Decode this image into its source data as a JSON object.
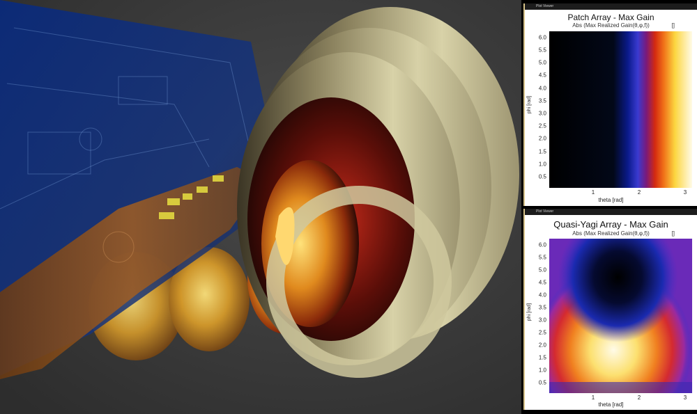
{
  "viewport": {
    "description_label": ""
  },
  "plots": [
    {
      "window_title": "Plot Viewer",
      "title": "Patch Array - Max Gain",
      "subtitle": "Abs (Max Realized Gain(θ,φ,f))",
      "unit": "[]",
      "xlabel": "theta [rad]",
      "ylabel": "phi [rad]",
      "yticks": [
        "6.0",
        "5.5",
        "5.0",
        "4.5",
        "4.0",
        "3.5",
        "3.0",
        "2.5",
        "2.0",
        "1.5",
        "1.0",
        "0.5"
      ],
      "xticks": [
        "1",
        "2",
        "3"
      ]
    },
    {
      "window_title": "Plot Viewer",
      "title": "Quasi-Yagi Array - Max Gain",
      "subtitle": "Abs (Max Realized Gain(θ,φ,f))",
      "unit": "[]",
      "xlabel": "theta [rad]",
      "ylabel": "phi [rad]",
      "yticks": [
        "6.0",
        "5.5",
        "5.0",
        "4.5",
        "4.0",
        "3.5",
        "3.0",
        "2.5",
        "2.0",
        "1.5",
        "1.0",
        "0.5"
      ],
      "xticks": [
        "1",
        "2",
        "3"
      ]
    }
  ],
  "chart_data": [
    {
      "type": "heatmap",
      "title": "Patch Array - Max Gain",
      "subtitle": "Abs (Max Realized Gain(θ,φ,f))",
      "xlabel": "theta [rad]",
      "ylabel": "phi [rad]",
      "xlim": [
        0,
        3.14
      ],
      "ylim": [
        0,
        6.28
      ],
      "xticks": [
        1,
        2,
        3
      ],
      "yticks": [
        0.5,
        1.0,
        1.5,
        2.0,
        2.5,
        3.0,
        3.5,
        4.0,
        4.5,
        5.0,
        5.5,
        6.0
      ],
      "colormap": "black-blue-red-yellow-white",
      "pattern": "gain increases with theta, roughly independent of phi"
    },
    {
      "type": "heatmap",
      "title": "Quasi-Yagi Array - Max Gain",
      "subtitle": "Abs (Max Realized Gain(θ,φ,f))",
      "xlabel": "theta [rad]",
      "ylabel": "phi [rad]",
      "xlim": [
        0,
        3.14
      ],
      "ylim": [
        0,
        6.28
      ],
      "xticks": [
        1,
        2,
        3
      ],
      "yticks": [
        0.5,
        1.0,
        1.5,
        2.0,
        2.5,
        3.0,
        3.5,
        4.0,
        4.5,
        5.0,
        5.5,
        6.0
      ],
      "colormap": "black-blue-red-yellow-white",
      "pattern": "peak gain near phi=1.6, theta=1.6; low gain near phi=4.5"
    }
  ]
}
